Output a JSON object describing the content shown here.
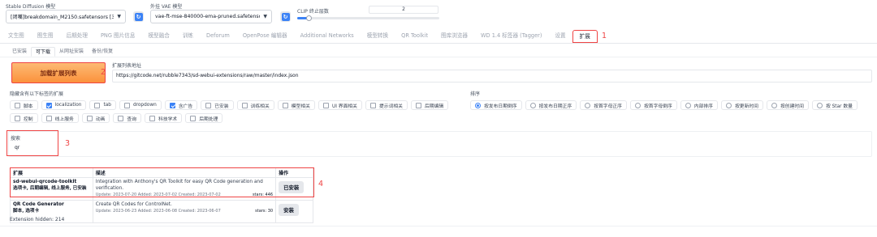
{
  "header": {
    "checkpoint_label": "Stable Diffusion 模型",
    "checkpoint_value": "[闭嘴]breakdomain_M2150.safetensors [364a13",
    "vae_label": "外挂 VAE 模型",
    "vae_value": "vae-ft-mse-840000-ema-pruned.safetensors",
    "clip_label": "CLIP 终止层数",
    "clip_value": "2",
    "clip_slider_fraction": 0.08,
    "refresh_glyph": "↻"
  },
  "main_tabs": [
    "文生图",
    "图生图",
    "后期处理",
    "PNG 图片信息",
    "模型融合",
    "训练",
    "Deforum",
    "OpenPose 编辑器",
    "Additional Networks",
    "模型转换",
    "QR Toolkit",
    "图库浏览器",
    "WD 1.4 标签器 (Tagger)",
    "设置",
    "扩展"
  ],
  "sub_tabs": [
    "已安装",
    "可下载",
    "从网址安装",
    "备份/恢复"
  ],
  "load_button_label": "加载扩展列表",
  "url_label": "扩展列表地址",
  "url_value": "https://gitcode.net/rubble7343/sd-webui-extensions/raw/master/index.json",
  "hide_label": "隐藏含有以下标签的扩展",
  "hide_tags": [
    {
      "label": "脚本",
      "checked": false
    },
    {
      "label": "localization",
      "checked": true
    },
    {
      "label": "tab",
      "checked": false
    },
    {
      "label": "dropdown",
      "checked": false
    },
    {
      "label": "含广告",
      "checked": true
    },
    {
      "label": "已安装",
      "checked": false
    },
    {
      "label": "训练相关",
      "checked": false
    },
    {
      "label": "模型相关",
      "checked": false
    },
    {
      "label": "UI 界面相关",
      "checked": false
    },
    {
      "label": "提示词相关",
      "checked": false
    },
    {
      "label": "后期编辑",
      "checked": false
    },
    {
      "label": "控制",
      "checked": false
    },
    {
      "label": "线上服务",
      "checked": false
    },
    {
      "label": "动画",
      "checked": false
    },
    {
      "label": "查询",
      "checked": false
    },
    {
      "label": "科技学术",
      "checked": false
    },
    {
      "label": "后期处理",
      "checked": false
    }
  ],
  "sort_label": "排序",
  "sort_options": [
    {
      "label": "按发布日期倒序",
      "selected": true
    },
    {
      "label": "按发布日期正序",
      "selected": false
    },
    {
      "label": "按首字母正序",
      "selected": false
    },
    {
      "label": "按首字母倒序",
      "selected": false
    },
    {
      "label": "内部排序",
      "selected": false
    },
    {
      "label": "按更新时间",
      "selected": false
    },
    {
      "label": "按创建时间",
      "selected": false
    },
    {
      "label": "按 Star 数量",
      "selected": false
    }
  ],
  "search_label": "搜索",
  "search_value": "qr",
  "table": {
    "col_ext": "扩展",
    "col_desc": "描述",
    "col_action": "操作",
    "rows": [
      {
        "name": "sd-webui-qrcode-toolkit",
        "tags": "选项卡, 后期编辑, 线上服务, 已安装",
        "desc": "Integration with Anthony's QR Toolkit for easy QR Code generation and verification.",
        "meta": "Update: 2023-07-20 Added: 2023-07-02 Created: 2023-07-02",
        "stars": "stars: 446",
        "action": "已安装"
      },
      {
        "name": "QR Code Generator",
        "tags": "脚本, 选项卡",
        "desc": "Create QR Codes for ControlNet.",
        "meta": "Update: 2023-06-23 Added: 2023-06-08 Created: 2023-06-07",
        "stars": "stars: 30",
        "action": "安装"
      }
    ]
  },
  "hidden_count_text": "Extension hidden: 214",
  "annotations": [
    "1",
    "2",
    "3",
    "4"
  ],
  "colors": {
    "accent_orange": "#f97316",
    "highlight_red": "#ef4444",
    "checkbox_blue": "#3b82f6"
  }
}
